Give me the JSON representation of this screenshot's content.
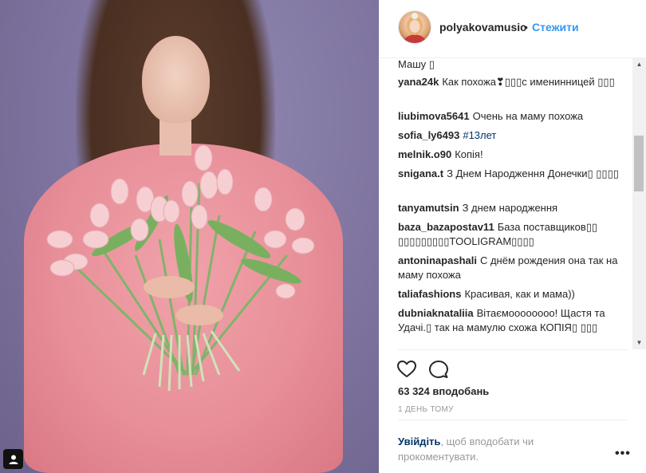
{
  "post": {
    "username": "polyakovamusic",
    "separator": "•",
    "follow_label": "Стежити",
    "likes": "63 324 вподобань",
    "timestamp": "1 ДЕНЬ ТОМУ",
    "login_link": "Увійдіть",
    "login_text": ", щоб вподобати чи прокоментувати.",
    "more_label": "•••"
  },
  "comments": [
    {
      "user": "",
      "text": "Машу ▯"
    },
    {
      "user": "yana24k",
      "text": "Как похожа❣▯▯▯с именинницей ▯▯▯"
    },
    {
      "user": "liubimova5641",
      "text": "Очень на маму похожа"
    },
    {
      "user": "sofia_ly6493",
      "text": "#13лет"
    },
    {
      "user": "melnik.o90",
      "text": "Копія!"
    },
    {
      "user": "snigana.t",
      "text": "З Днем Народження Донечки▯ ▯▯▯▯"
    },
    {
      "user": "tanyamutsin",
      "text": "З днем народження"
    },
    {
      "user": "baza_bazapostav11",
      "text": "База поставщиков▯▯ ▯▯▯▯▯▯▯▯▯TOOLIGRAM▯▯▯▯"
    },
    {
      "user": "antoninapashali",
      "text": "С днём рождения она так на маму похожа"
    },
    {
      "user": "taliafashions",
      "text": "Красивая, как и мама))"
    },
    {
      "user": "dubniaknataliia",
      "text": "Вітаємоооооооо! Щастя та Удачі.▯ так на мамулю схожа КОПІЯ▯ ▯▯▯"
    }
  ],
  "icons": {
    "like": "heart-icon",
    "comment": "comment-icon",
    "user_tag": "user-icon",
    "scroll_up": "chevron-up-icon",
    "scroll_down": "chevron-down-icon"
  },
  "colors": {
    "link": "#3897f0",
    "username_link": "#003569",
    "muted": "#999999"
  }
}
